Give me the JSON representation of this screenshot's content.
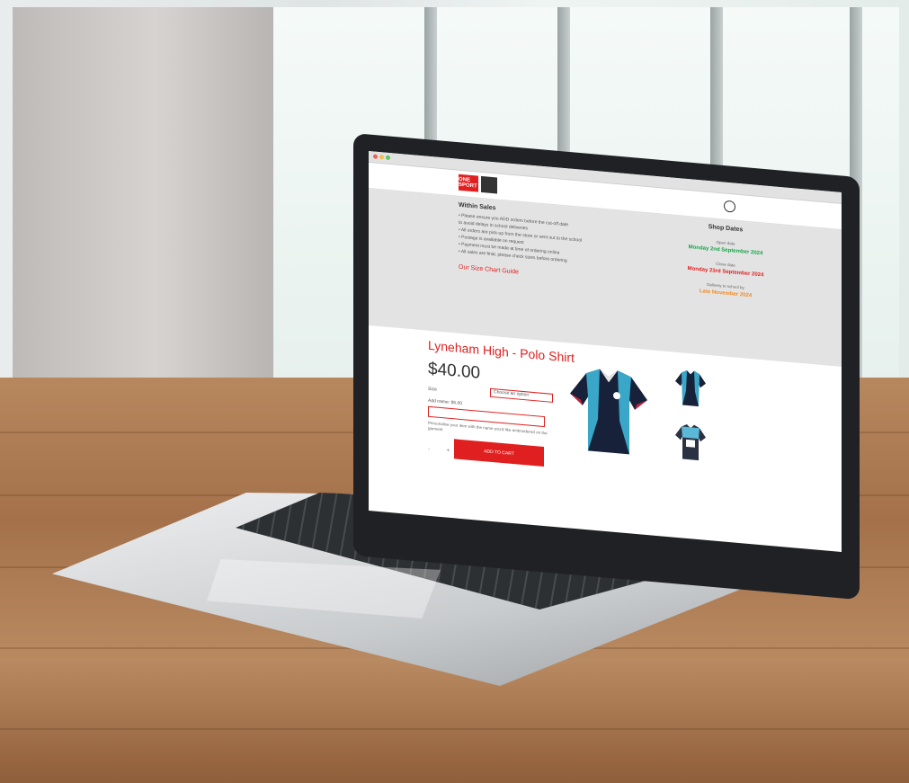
{
  "site": {
    "logo_text": "ONE SPORT",
    "info": {
      "left_heading": "Within Sales",
      "bullets": [
        "• Please ensure you ADD orders before the cut-off date",
        "  to avoid delays in school deliveries",
        "• All orders are pick-up from the store or sent out to the school",
        "• Postage is available on request",
        "• Payment must be made at time of ordering online",
        "• All sales are final, please check sizes before ordering"
      ],
      "red_link": "Our Size Chart Guide",
      "right_heading": "Shop Dates",
      "dates": [
        {
          "label": "Open date",
          "value": "Monday 2nd September 2024",
          "tone": "green"
        },
        {
          "label": "Close date",
          "value": "Monday 23rd September 2024",
          "tone": "red"
        },
        {
          "label": "Delivery to school by",
          "value": "Late November 2024",
          "tone": "orange"
        }
      ]
    },
    "product": {
      "title": "Lyneham High - Polo Shirt",
      "price": "$40.00",
      "size_label": "Size",
      "size_placeholder": "Choose an option",
      "availability": "Add name: $5.00",
      "note": "Personalise your item with the name you'd like embroidered on the garment",
      "qty_minus": "-",
      "qty_plus": "+",
      "add_button": "ADD TO CART"
    }
  }
}
